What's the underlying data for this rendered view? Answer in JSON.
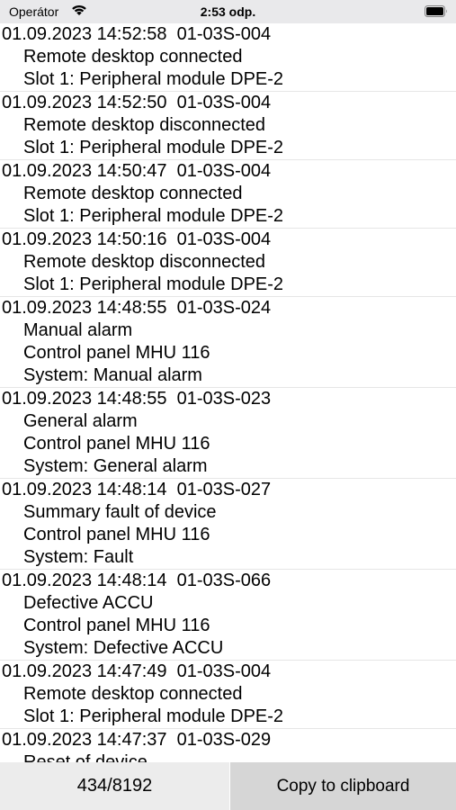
{
  "status_bar": {
    "carrier": "Operátor",
    "time": "2:53 odp."
  },
  "entries": [
    {
      "header": "01.09.2023 14:52:58  01-03S-004",
      "lines": [
        "Remote desktop connected",
        "Slot 1: Peripheral module DPE-2"
      ]
    },
    {
      "header": "01.09.2023 14:52:50  01-03S-004",
      "lines": [
        "Remote desktop disconnected",
        "Slot 1: Peripheral module DPE-2"
      ]
    },
    {
      "header": "01.09.2023 14:50:47  01-03S-004",
      "lines": [
        "Remote desktop connected",
        "Slot 1: Peripheral module DPE-2"
      ]
    },
    {
      "header": "01.09.2023 14:50:16  01-03S-004",
      "lines": [
        "Remote desktop disconnected",
        "Slot 1: Peripheral module DPE-2"
      ]
    },
    {
      "header": "01.09.2023 14:48:55  01-03S-024",
      "lines": [
        "Manual alarm",
        "Control panel MHU 116",
        "System: Manual alarm"
      ]
    },
    {
      "header": "01.09.2023 14:48:55  01-03S-023",
      "lines": [
        "General alarm",
        "Control panel MHU 116",
        "System: General alarm"
      ]
    },
    {
      "header": "01.09.2023 14:48:14  01-03S-027",
      "lines": [
        "Summary fault of device",
        "Control panel MHU 116",
        "System: Fault"
      ]
    },
    {
      "header": "01.09.2023 14:48:14  01-03S-066",
      "lines": [
        "Defective ACCU",
        "Control panel MHU 116",
        "System: Defective ACCU"
      ]
    },
    {
      "header": "01.09.2023 14:47:49  01-03S-004",
      "lines": [
        "Remote desktop connected",
        "Slot 1: Peripheral module DPE-2"
      ]
    },
    {
      "header": "01.09.2023 14:47:37  01-03S-029",
      "lines": [
        "Reset of device"
      ]
    }
  ],
  "footer": {
    "counter": "434/8192",
    "copy_label": "Copy to clipboard"
  }
}
